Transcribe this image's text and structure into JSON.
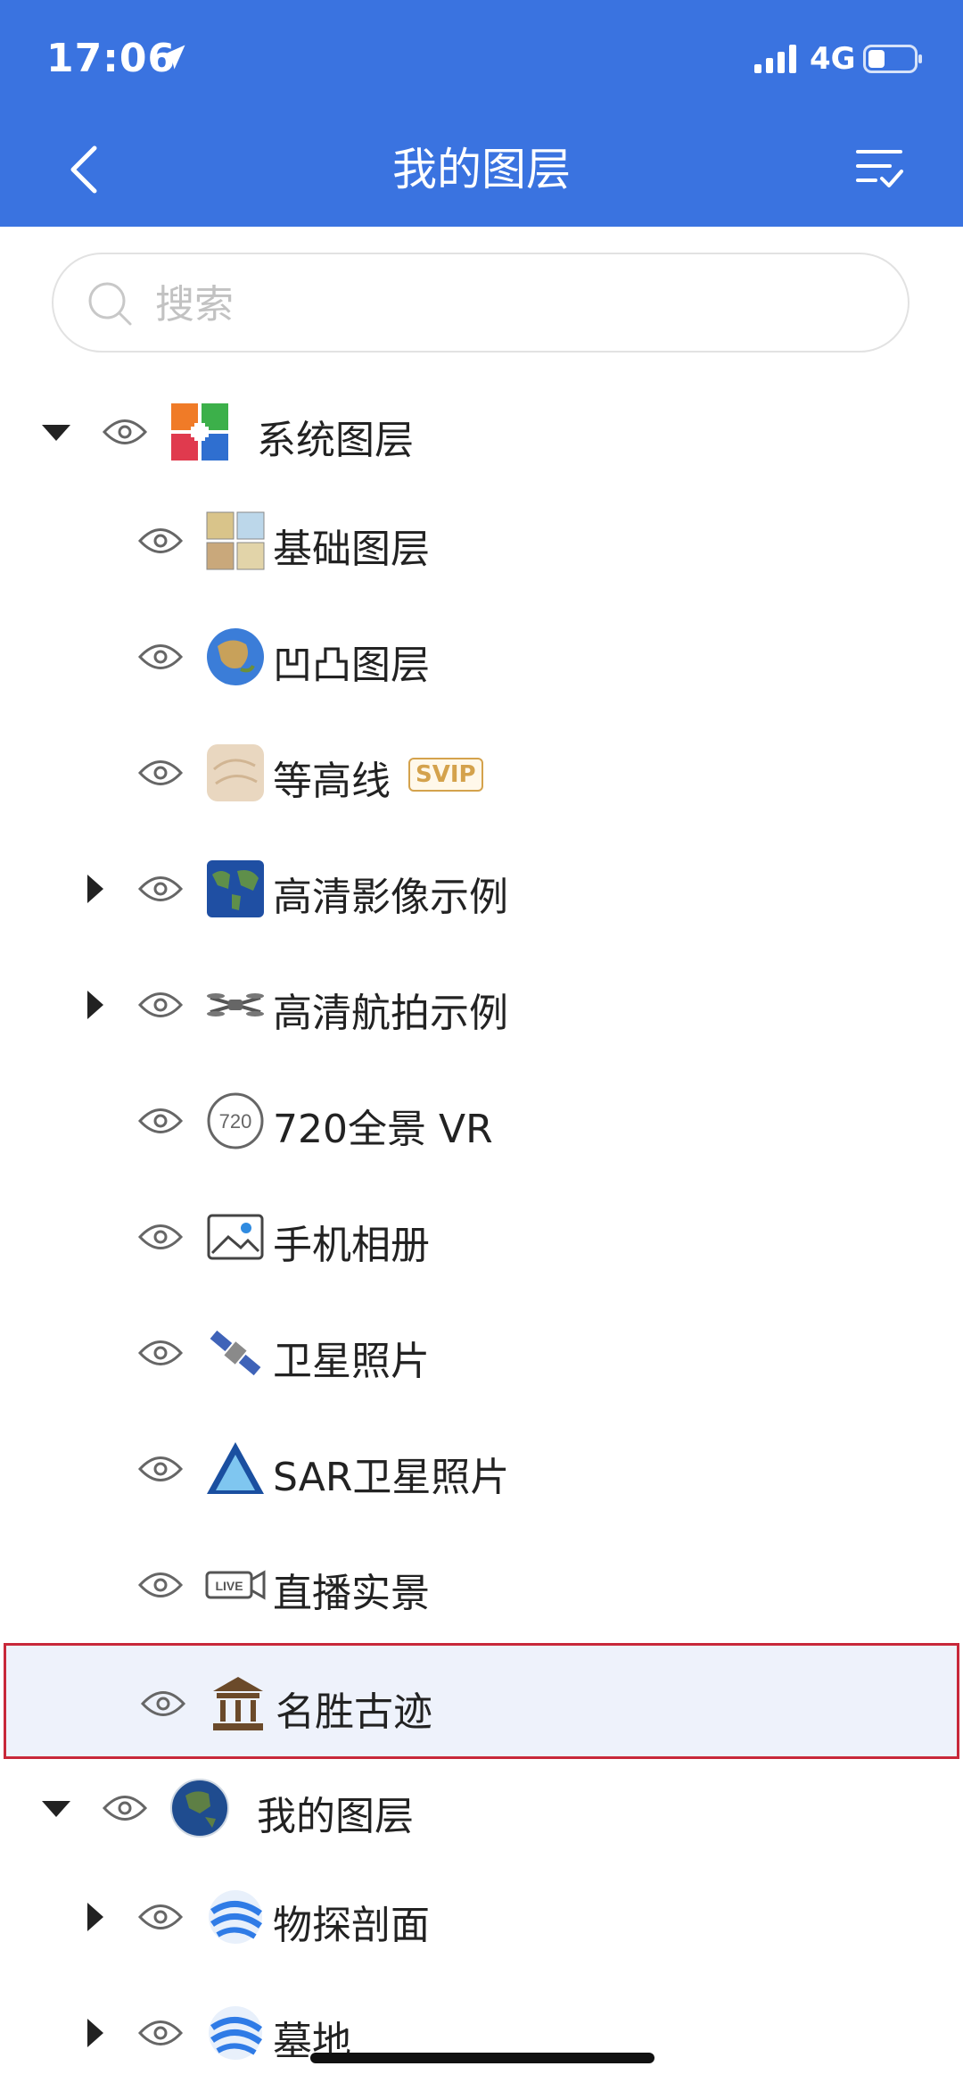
{
  "status_bar": {
    "time": "17:06",
    "network": "4G"
  },
  "header": {
    "title": "我的图层"
  },
  "search": {
    "placeholder": "搜索"
  },
  "tree": {
    "system": {
      "label": "系统图层"
    },
    "base": {
      "label": "基础图层"
    },
    "relief": {
      "label": "凹凸图层"
    },
    "contour": {
      "label": "等高线",
      "badge": "SVIP"
    },
    "hd_image": {
      "label": "高清影像示例"
    },
    "hd_aerial": {
      "label": "高清航拍示例"
    },
    "vr720": {
      "label": "720全景 VR"
    },
    "album": {
      "label": "手机相册"
    },
    "satellite": {
      "label": "卫星照片"
    },
    "sar": {
      "label": "SAR卫星照片"
    },
    "live": {
      "label": "直播实景"
    },
    "scenic": {
      "label": "名胜古迹"
    },
    "my_layers": {
      "label": "我的图层"
    },
    "geophysics": {
      "label": "物探剖面"
    },
    "cemetery": {
      "label": "墓地"
    }
  },
  "colors": {
    "header": "#3a73e0",
    "highlight_border": "#c8283a",
    "highlight_bg": "#eef2fb",
    "svip": "#d4a24c"
  }
}
